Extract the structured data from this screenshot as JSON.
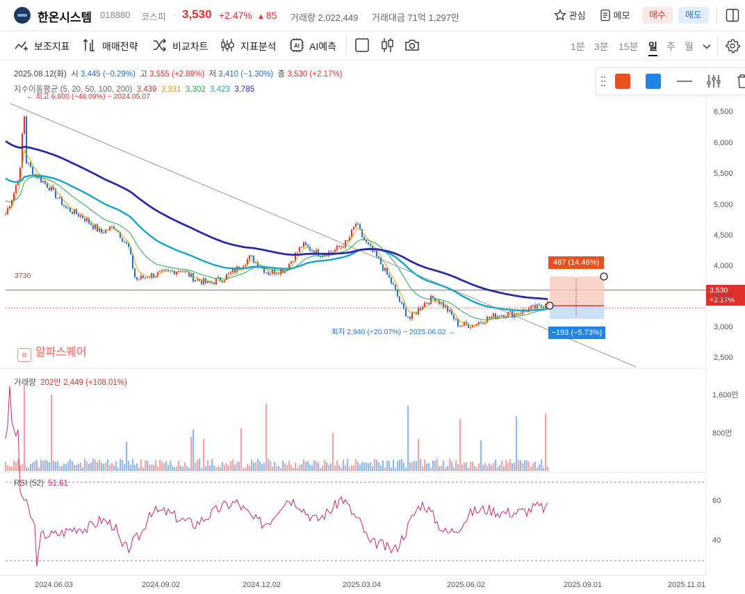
{
  "header": {
    "name": "한온시스템",
    "code": "018880",
    "market": "코스피",
    "dot": "·",
    "price": "3,530",
    "pct": "+2.47%",
    "change": "85",
    "volume": "거래량 2,022,449",
    "amount": "거래대금 71억 1,297만",
    "watch": "관심",
    "memo": "메모",
    "buy": "매수",
    "sell": "매도"
  },
  "toolbar": {
    "items": [
      "보조지표",
      "매매전략",
      "비교차트",
      "지표분석",
      "AI예측"
    ],
    "timeframes": [
      "1분",
      "3분",
      "15분",
      "일",
      "주",
      "월"
    ],
    "selected": "일"
  },
  "info": {
    "date": "2025.08.12(화)",
    "open_label": "시",
    "open": "3,445 (−0.29%)",
    "high_label": "고",
    "high": "3,555 (+2.89%)",
    "low_label": "저",
    "low": "3,410 (−1.30%)",
    "close_label": "종",
    "close": "3,530 (+2.17%)",
    "ma_label": "지수이동평균 (5, 20, 50, 100, 200)",
    "ma_values": [
      "3,439",
      "3,331",
      "3,302",
      "3,423",
      "3,785"
    ],
    "max_label": "최고 6,800 (−48.09%) − 2024.05.07",
    "min_label": "최지 2,940 (+20.07%) − 2025.06.02",
    "hline_label": "3730",
    "current_tag": "3,530",
    "current_tag_pct": "+2.17%",
    "up_box": "487 (14.46%)",
    "down_box": "−193 (−5.73%)",
    "watermark": "알파스퀘어"
  },
  "price_axis": [
    "6,500",
    "6,000",
    "5,500",
    "5,000",
    "4,500",
    "4,000",
    "3,500",
    "3,000",
    "2,500"
  ],
  "volume": {
    "label": "거래량",
    "value": "202만 2,449 (+108.01%)",
    "axis": [
      "1,600만",
      "800만"
    ]
  },
  "rsi": {
    "label": "RSI (52)",
    "value": "51.61",
    "axis": [
      "60",
      "40"
    ]
  },
  "date_axis": [
    "2024.06.03",
    "2024.09.02",
    "2024.12.02",
    "2025.03.04",
    "2025.06.02",
    "2025.09.01",
    "2025.11.01"
  ],
  "colors": {
    "up": "#e0302e",
    "down": "#1f6fd8",
    "ma5": "#e0302e",
    "ma20": "#d9a400",
    "ma50": "#27a84f",
    "ma100": "#1aa6c8",
    "ma200": "#2a2aa8",
    "rsi": "#c8246e",
    "draw_red": "#e8501f",
    "draw_blue": "#1f84e8"
  }
}
